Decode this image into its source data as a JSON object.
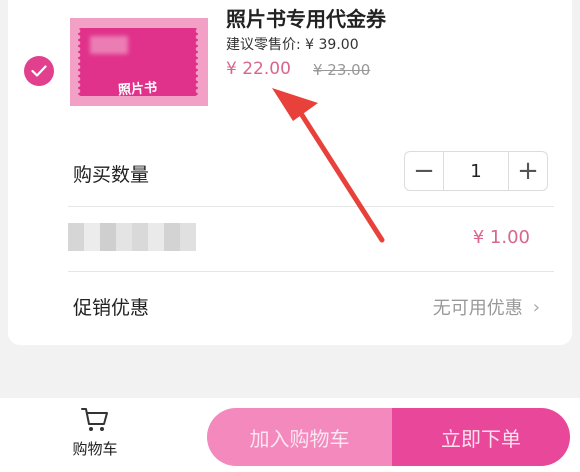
{
  "product": {
    "thumb_text": "照片书",
    "title": "照片书专用代金券",
    "msrp": "建议零售价: ¥ 39.00",
    "price": "¥ 22.00",
    "old_price": "¥ 23.00",
    "selected": true
  },
  "quantity": {
    "label": "购买数量",
    "minus": "−",
    "value": "1",
    "plus": "+"
  },
  "fee_row": {
    "amount": "¥ 1.00"
  },
  "promo": {
    "label": "促销优惠",
    "value": "无可用优惠",
    "chevron": "›"
  },
  "bottom": {
    "cart_label": "购物车",
    "add_to_cart": "加入购物车",
    "buy_now": "立即下单"
  },
  "colors": {
    "accent": "#e23f8f",
    "price": "#d8668f",
    "arrow": "#e8403a"
  },
  "icons": [
    "check-icon",
    "cart-icon",
    "chevron-right-icon",
    "minus-icon",
    "plus-icon",
    "red-arrow-annotation"
  ]
}
